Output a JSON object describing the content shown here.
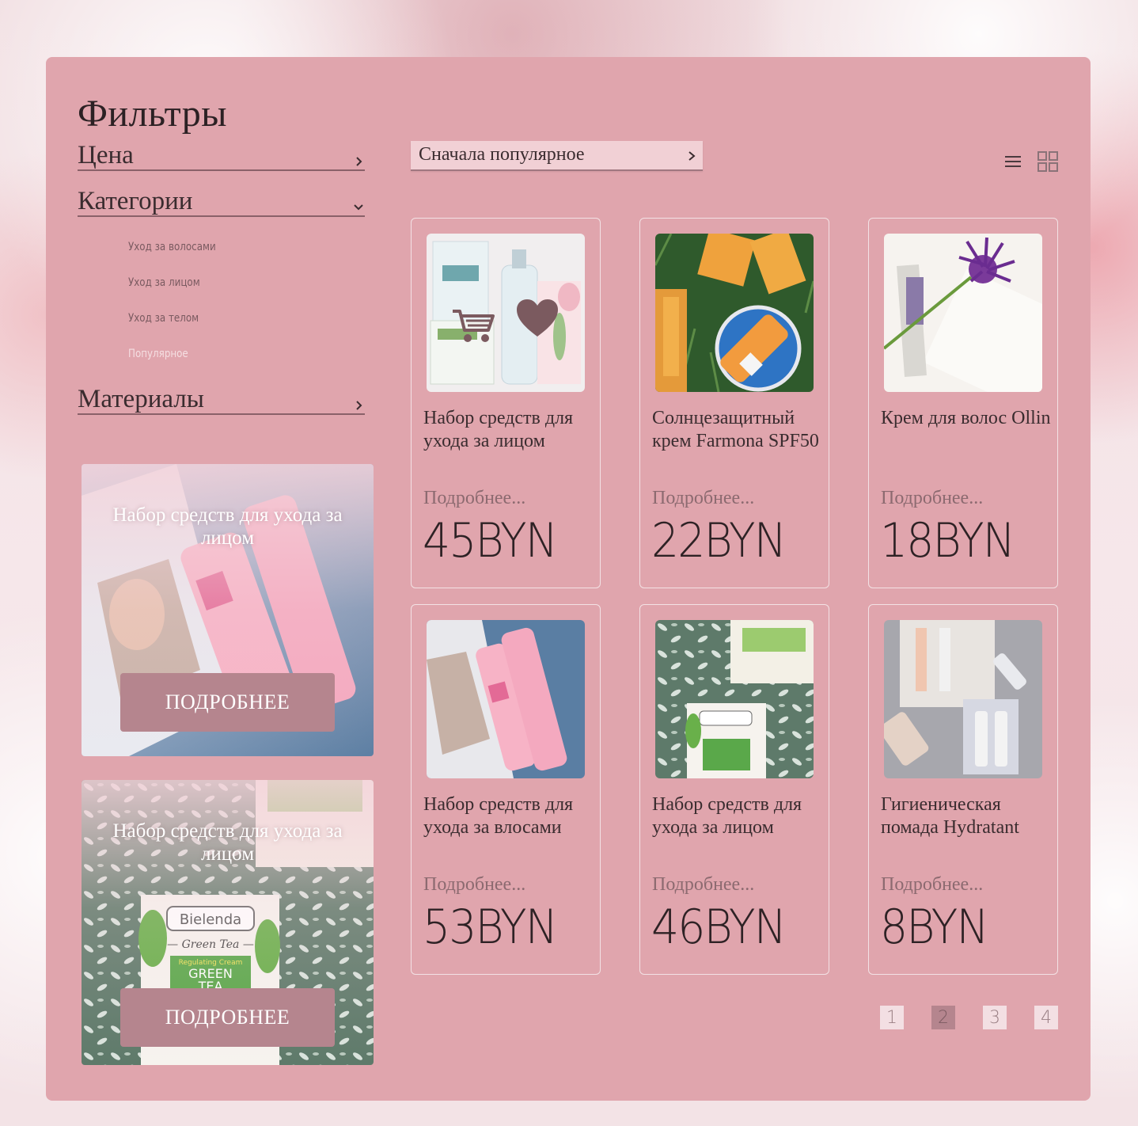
{
  "filters": {
    "title": "Фильтры",
    "price_label": "Цена",
    "categories_label": "Категории",
    "materials_label": "Материалы",
    "category_items": [
      "Уход за волосами",
      "Уход за лицом",
      "Уход за телом",
      "Популярное"
    ]
  },
  "promos": [
    {
      "title": "Набор средств для ухода за лицом",
      "button": "ПОДРОБНЕЕ"
    },
    {
      "title": "Набор средств для ухода за лицом",
      "button": "ПОДРОБНЕЕ"
    }
  ],
  "sort": {
    "label": "Сначала популярное"
  },
  "view_icons": [
    "list-view-icon",
    "grid-view-icon"
  ],
  "products": [
    {
      "name": "Набор средств для ухода за лицом",
      "more": "Подробнее...",
      "price": "45BYN"
    },
    {
      "name": "Солнцезащитный крем Farmona SPF50",
      "more": "Подробнее...",
      "price": "22BYN"
    },
    {
      "name": "Крем для волос Ollin",
      "more": "Подробнее...",
      "price": "18BYN"
    },
    {
      "name": "Набор средств для ухода за влосами",
      "more": "Подробнее...",
      "price": "53BYN"
    },
    {
      "name": "Набор средств для ухода за лицом",
      "more": "Подробнее...",
      "price": "46BYN"
    },
    {
      "name": "Гигиеническая помада Hydratant",
      "more": "Подробнее...",
      "price": "8BYN"
    }
  ],
  "pagination": {
    "pages": [
      "1",
      "2",
      "3",
      "4"
    ],
    "current": "2"
  },
  "colors": {
    "panel": "#e0a5ad",
    "button": "#b5858e",
    "text": "#3a2c2f",
    "favorite": "#7b5a5f"
  }
}
